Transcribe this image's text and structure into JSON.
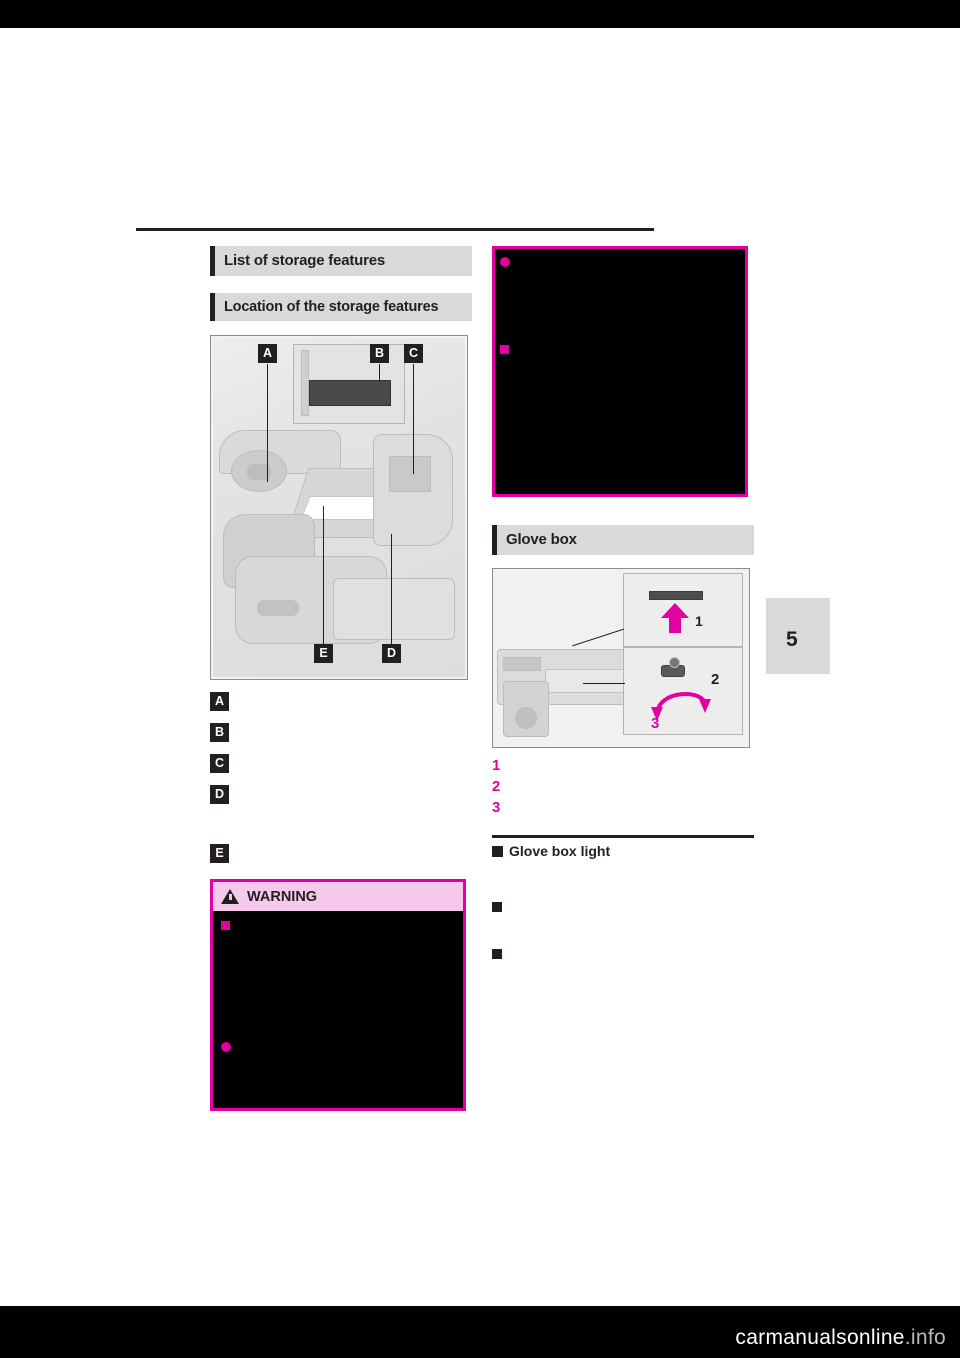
{
  "page": {
    "chapter_number": "5",
    "watermark": "carmanualsonline.info"
  },
  "left_column": {
    "section_title": "List of storage features",
    "subsection_title": "Location of the storage features",
    "illustration": {
      "name": "vehicle-interior-storage-locations",
      "callouts": [
        "A",
        "B",
        "C",
        "D",
        "E"
      ]
    },
    "items": [
      {
        "letter": "A",
        "text": ""
      },
      {
        "letter": "B",
        "text": ""
      },
      {
        "letter": "C",
        "text": ""
      },
      {
        "letter": "D",
        "text": ""
      },
      {
        "letter": "E",
        "text": ""
      }
    ],
    "warning": {
      "title": "WARNING",
      "items": [
        "",
        ""
      ]
    }
  },
  "right_column": {
    "notice_box": {
      "items": [
        "",
        ""
      ]
    },
    "glove_box": {
      "section_title": "Glove box",
      "illustration": {
        "name": "glove-box-operation",
        "callouts": [
          "1",
          "2",
          "3"
        ]
      },
      "steps": [
        {
          "number": "1",
          "text": ""
        },
        {
          "number": "2",
          "text": ""
        },
        {
          "number": "3",
          "text": ""
        }
      ],
      "sub_section_title": "Glove box light",
      "sub_items": [
        "",
        ""
      ]
    }
  }
}
